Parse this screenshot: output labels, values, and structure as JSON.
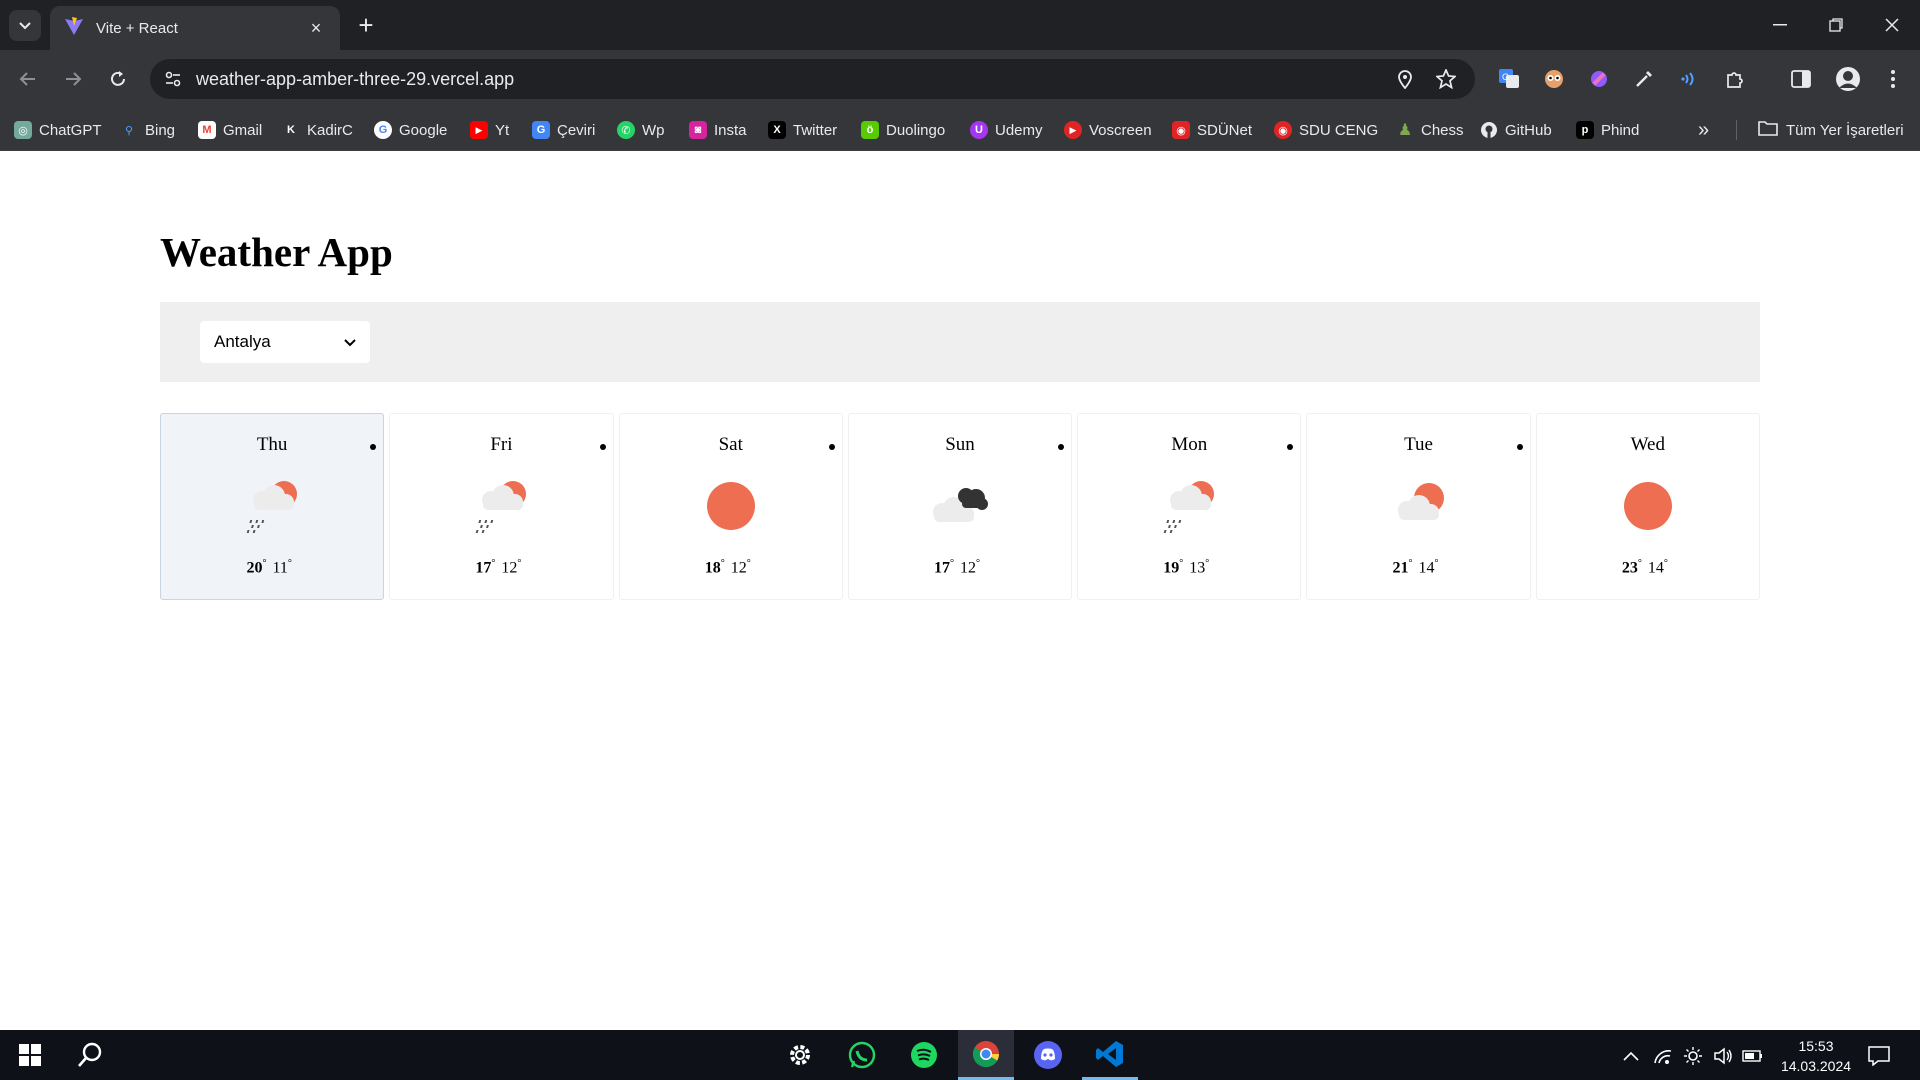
{
  "browser": {
    "tab_title": "Vite + React",
    "tab_close": "×",
    "new_tab": "+",
    "url": "weather-app-amber-three-29.vercel.app",
    "more_bookmarks": "»",
    "all_bookmarks": "Tüm Yer İşaretleri",
    "bookmarks": [
      {
        "label": "ChatGPT",
        "icon": "chatgpt-icon",
        "color": "#74aa9c",
        "glyph": "◎"
      },
      {
        "label": "Bing",
        "icon": "bing-icon",
        "color": "#35363a",
        "glyph": "🔍"
      },
      {
        "label": "Gmail",
        "icon": "gmail-icon",
        "color": "#ea4335",
        "glyph": "M"
      },
      {
        "label": "KadirC",
        "icon": "kadirc-icon",
        "color": "#35363a",
        "glyph": "K"
      },
      {
        "label": "Google",
        "icon": "google-icon",
        "color": "#4285f4",
        "glyph": "G"
      },
      {
        "label": "Yt",
        "icon": "youtube-icon",
        "color": "#ff0000",
        "glyph": "▶"
      },
      {
        "label": "Çeviri",
        "icon": "translate-icon",
        "color": "#4285f4",
        "glyph": "G"
      },
      {
        "label": "Wp",
        "icon": "whatsapp-icon",
        "color": "#25d366",
        "glyph": "✆"
      },
      {
        "label": "Insta",
        "icon": "instagram-icon",
        "color": "#d6249f",
        "glyph": "◙"
      },
      {
        "label": "Twitter",
        "icon": "x-icon",
        "color": "#000000",
        "glyph": "X"
      },
      {
        "label": "Duolingo",
        "icon": "duolingo-icon",
        "color": "#58cc02",
        "glyph": "ö"
      },
      {
        "label": "Udemy",
        "icon": "udemy-icon",
        "color": "#a435f0",
        "glyph": "U"
      },
      {
        "label": "Voscreen",
        "icon": "voscreen-icon",
        "color": "#e02424",
        "glyph": "▶"
      },
      {
        "label": "SDÜNet",
        "icon": "sdunet-icon",
        "color": "#e02424",
        "glyph": "◉"
      },
      {
        "label": "SDU CENG",
        "icon": "sdu-ceng-icon",
        "color": "#e02424",
        "glyph": "◉"
      },
      {
        "label": "Chess",
        "icon": "chess-icon",
        "color": "#7fa650",
        "glyph": "♟"
      },
      {
        "label": "GitHub",
        "icon": "github-icon",
        "color": "#35363a",
        "glyph": "●"
      },
      {
        "label": "Phind",
        "icon": "phind-icon",
        "color": "#000000",
        "glyph": "p"
      }
    ]
  },
  "app": {
    "title": "Weather App",
    "city": {
      "selected": "Antalya"
    },
    "accent_sun": "#ee6e52",
    "days": [
      {
        "day": "Thu",
        "icon": "partly-cloudy-rain-icon",
        "high": "20",
        "low": "11",
        "selected": true
      },
      {
        "day": "Fri",
        "icon": "partly-cloudy-rain-icon",
        "high": "17",
        "low": "12",
        "selected": false
      },
      {
        "day": "Sat",
        "icon": "sun-icon",
        "high": "18",
        "low": "12",
        "selected": false
      },
      {
        "day": "Sun",
        "icon": "dark-clouds-icon",
        "high": "17",
        "low": "12",
        "selected": false
      },
      {
        "day": "Mon",
        "icon": "partly-cloudy-rain-icon",
        "high": "19",
        "low": "13",
        "selected": false
      },
      {
        "day": "Tue",
        "icon": "partly-cloudy-icon",
        "high": "21",
        "low": "14",
        "selected": false
      },
      {
        "day": "Wed",
        "icon": "sun-icon",
        "high": "23",
        "low": "14",
        "selected": false
      }
    ],
    "degree": "°"
  },
  "taskbar": {
    "time": "15:53",
    "date": "14.03.2024"
  }
}
